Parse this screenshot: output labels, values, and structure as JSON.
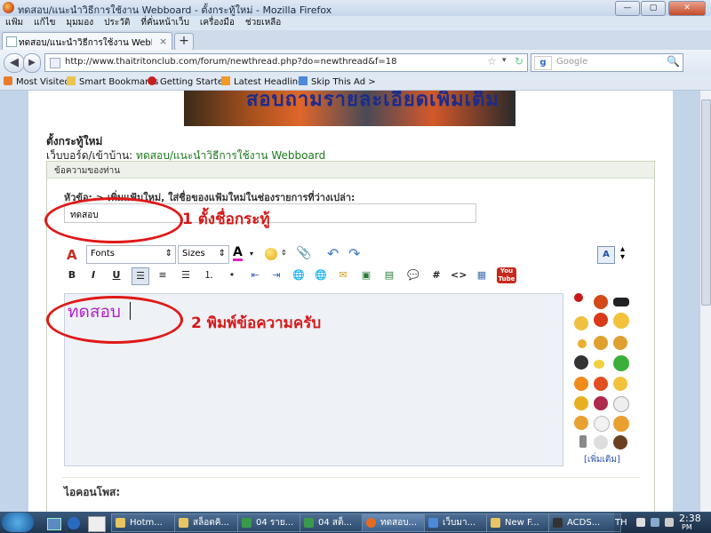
{
  "window": {
    "title": "ทดสอบ/แนะนำวิธีการใช้งาน Webboard - ตั้งกระทู้ใหม่ - Mozilla Firefox",
    "min": "—",
    "max": "▢",
    "close": "✕"
  },
  "menu": [
    "แฟ้ม",
    "แก้ไข",
    "มุมมอง",
    "ประวัติ",
    "ที่คั่นหน้าเว็บ",
    "เครื่องมือ",
    "ช่วยเหลือ"
  ],
  "tab": {
    "title": "ทดสอบ/แนะนำวิธีการใช้งาน Webboard - ตั้ง...",
    "close": "×",
    "new": "+"
  },
  "nav": {
    "back": "◀",
    "forward": "▶",
    "url": "http://www.thaitritonclub.com/forum/newthread.php?do=newthread&f=18",
    "star": "☆",
    "reload": "↻",
    "search_placeholder": "Google",
    "search_logo": "g"
  },
  "bookmarks": [
    "Most Visited",
    "Smart Bookmarks",
    "Getting Started",
    "Latest Headlines",
    "Skip This Ad >"
  ],
  "page": {
    "banner_text": "สอบถามรายละเอียดเพิ่มเติม",
    "heading": "ตั้งกระทู้ใหม่",
    "crumb_prefix": "เว็บบอร์ด/เข้าบ้าน: ",
    "crumb_link": "ทดสอบ/แนะนำวิธีการใช้งาน Webboard",
    "form_header": "ข้อความของท่าน",
    "subject_label": "หัวข้อ: > เพิ่มแฟ้มใหม่, ใส่ชื่อของแฟ้มใหม่ในช่องรายการที่ว่างเปล่า:",
    "subject_value": "ทดสอบ",
    "annotation1": "1 ตั้งชื่อกระทู้",
    "annotation2": "2 พิมพ์ข้อความครับ",
    "editor_text": "ทดสอบ",
    "toolbar": {
      "fonts": "Fonts",
      "sizes": "Sizes",
      "bold": "B",
      "italic": "I",
      "underline": "U"
    },
    "more_smilies": "[เพิ่มเติม]",
    "icon_label": "ไอคอนโพส:"
  },
  "taskbar": {
    "apps": [
      "Hotm...",
      "สล็อตคิ...",
      "04 ราย...",
      "04 สต็...",
      "ทดสอบ...",
      "เว็บมา...",
      "New F...",
      "ACDS..."
    ],
    "lang": "TH",
    "time": "2:38",
    "ampm": "PM"
  },
  "colors": {
    "accent_red": "#d41a1a",
    "editor_text": "#b122c9",
    "link_green": "#1b7a1b"
  }
}
